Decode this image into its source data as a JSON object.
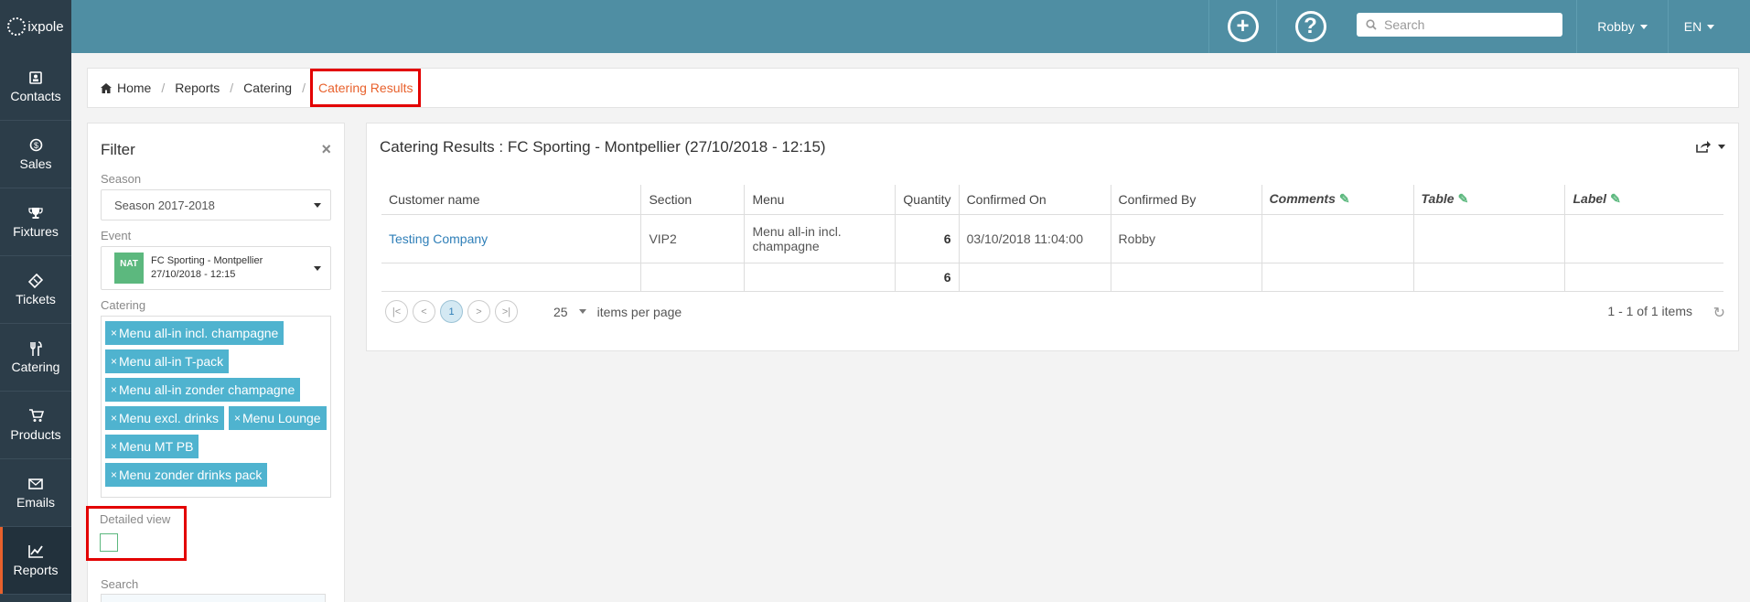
{
  "brand": {
    "name": "ixpole"
  },
  "topbar": {
    "add_icon": "plus-circle-icon",
    "help_icon": "question-circle-icon",
    "search_placeholder": "Search",
    "user": "Robby",
    "language": "EN"
  },
  "sidebar": {
    "items": [
      {
        "label": "Contacts",
        "icon": "address-card-icon"
      },
      {
        "label": "Sales",
        "icon": "money-icon"
      },
      {
        "label": "Fixtures",
        "icon": "trophy-icon"
      },
      {
        "label": "Tickets",
        "icon": "ticket-icon"
      },
      {
        "label": "Catering",
        "icon": "cutlery-icon"
      },
      {
        "label": "Products",
        "icon": "cart-icon"
      },
      {
        "label": "Emails",
        "icon": "envelope-icon"
      },
      {
        "label": "Reports",
        "icon": "chart-icon",
        "active": true
      }
    ]
  },
  "breadcrumb": {
    "items": [
      "Home",
      "Reports",
      "Catering"
    ],
    "current": "Catering Results"
  },
  "filter": {
    "title": "Filter",
    "season_label": "Season",
    "season_value": "Season 2017-2018",
    "event_label": "Event",
    "event_badge": "NAT",
    "event_name": "FC Sporting - Montpellier",
    "event_date": "27/10/2018 - 12:15",
    "catering_label": "Catering",
    "catering_tags": [
      "Menu all-in incl. champagne",
      "Menu all-in T-pack",
      "Menu all-in zonder champagne",
      "Menu excl. drinks",
      "Menu Lounge",
      "Menu MT PB",
      "Menu zonder drinks pack"
    ],
    "detailed_view_label": "Detailed view",
    "search_label": "Search"
  },
  "results": {
    "title": "Catering Results : FC Sporting - Montpellier (27/10/2018 - 12:15)",
    "columns": [
      "Customer name",
      "Section",
      "Menu",
      "Quantity",
      "Confirmed On",
      "Confirmed By",
      "Comments",
      "Table",
      "Label"
    ],
    "rows": [
      {
        "customer": "Testing Company",
        "section": "VIP2",
        "menu": "Menu all-in incl. champagne",
        "quantity": "6",
        "confirmed_on": "03/10/2018 11:04:00",
        "confirmed_by": "Robby",
        "comments": "",
        "table": "",
        "label": ""
      }
    ],
    "total_quantity": "6",
    "pager": {
      "current_page": "1",
      "page_size": "25",
      "items_per_page_label": "items per page",
      "info": "1 - 1 of 1 items"
    }
  },
  "colors": {
    "topbar": "#4f8ea3",
    "sidebar": "#2c3d49",
    "accent": "#e8612c",
    "tag": "#4fb3cf",
    "highlight_box": "#e30000"
  }
}
